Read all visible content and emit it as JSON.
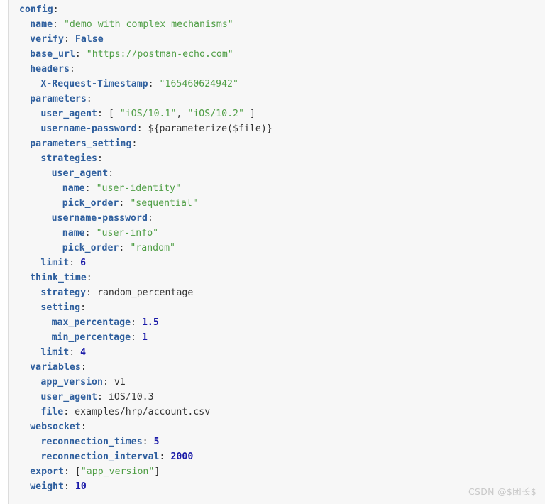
{
  "editor": {
    "language": "yaml",
    "background_color": "#f7f7f7",
    "page_background_color": "#ffffff",
    "gutter_border_color": "#dcdcdc",
    "colors": {
      "key": "#2f5f9e",
      "string": "#4f9e45",
      "number": "#1a1aa8",
      "constant": "#2f5f9e",
      "plain": "#333333",
      "punctuation": "#333333"
    },
    "lines": [
      {
        "indent": 0,
        "tokens": [
          {
            "t": "key",
            "v": "config"
          },
          {
            "t": "colon",
            "v": ":"
          }
        ]
      },
      {
        "indent": 1,
        "tokens": [
          {
            "t": "key",
            "v": "name"
          },
          {
            "t": "colon",
            "v": ": "
          },
          {
            "t": "str",
            "v": "\"demo with complex mechanisms\""
          }
        ]
      },
      {
        "indent": 1,
        "tokens": [
          {
            "t": "key",
            "v": "verify"
          },
          {
            "t": "colon",
            "v": ": "
          },
          {
            "t": "const",
            "v": "False"
          }
        ]
      },
      {
        "indent": 1,
        "tokens": [
          {
            "t": "key",
            "v": "base_url"
          },
          {
            "t": "colon",
            "v": ": "
          },
          {
            "t": "str",
            "v": "\"https://postman-echo.com\""
          }
        ]
      },
      {
        "indent": 1,
        "tokens": [
          {
            "t": "key",
            "v": "headers"
          },
          {
            "t": "colon",
            "v": ":"
          }
        ]
      },
      {
        "indent": 2,
        "tokens": [
          {
            "t": "key",
            "v": "X-Request-Timestamp"
          },
          {
            "t": "colon",
            "v": ": "
          },
          {
            "t": "str",
            "v": "\"165460624942\""
          }
        ]
      },
      {
        "indent": 1,
        "tokens": [
          {
            "t": "key",
            "v": "parameters"
          },
          {
            "t": "colon",
            "v": ":"
          }
        ]
      },
      {
        "indent": 2,
        "tokens": [
          {
            "t": "key",
            "v": "user_agent"
          },
          {
            "t": "colon",
            "v": ": "
          },
          {
            "t": "punct",
            "v": "[ "
          },
          {
            "t": "str",
            "v": "\"iOS/10.1\""
          },
          {
            "t": "punct",
            "v": ", "
          },
          {
            "t": "str",
            "v": "\"iOS/10.2\""
          },
          {
            "t": "punct",
            "v": " ]"
          }
        ]
      },
      {
        "indent": 2,
        "tokens": [
          {
            "t": "key",
            "v": "username-password"
          },
          {
            "t": "colon",
            "v": ": "
          },
          {
            "t": "plain",
            "v": "${parameterize($file)}"
          }
        ]
      },
      {
        "indent": 1,
        "tokens": [
          {
            "t": "key",
            "v": "parameters_setting"
          },
          {
            "t": "colon",
            "v": ":"
          }
        ]
      },
      {
        "indent": 2,
        "tokens": [
          {
            "t": "key",
            "v": "strategies"
          },
          {
            "t": "colon",
            "v": ":"
          }
        ]
      },
      {
        "indent": 3,
        "tokens": [
          {
            "t": "key",
            "v": "user_agent"
          },
          {
            "t": "colon",
            "v": ":"
          }
        ]
      },
      {
        "indent": 4,
        "tokens": [
          {
            "t": "key",
            "v": "name"
          },
          {
            "t": "colon",
            "v": ": "
          },
          {
            "t": "str",
            "v": "\"user-identity\""
          }
        ]
      },
      {
        "indent": 4,
        "tokens": [
          {
            "t": "key",
            "v": "pick_order"
          },
          {
            "t": "colon",
            "v": ": "
          },
          {
            "t": "str",
            "v": "\"sequential\""
          }
        ]
      },
      {
        "indent": 3,
        "tokens": [
          {
            "t": "key",
            "v": "username-password"
          },
          {
            "t": "colon",
            "v": ":"
          }
        ]
      },
      {
        "indent": 4,
        "tokens": [
          {
            "t": "key",
            "v": "name"
          },
          {
            "t": "colon",
            "v": ": "
          },
          {
            "t": "str",
            "v": "\"user-info\""
          }
        ]
      },
      {
        "indent": 4,
        "tokens": [
          {
            "t": "key",
            "v": "pick_order"
          },
          {
            "t": "colon",
            "v": ": "
          },
          {
            "t": "str",
            "v": "\"random\""
          }
        ]
      },
      {
        "indent": 2,
        "tokens": [
          {
            "t": "key",
            "v": "limit"
          },
          {
            "t": "colon",
            "v": ": "
          },
          {
            "t": "num",
            "v": "6"
          }
        ]
      },
      {
        "indent": 1,
        "tokens": [
          {
            "t": "key",
            "v": "think_time"
          },
          {
            "t": "colon",
            "v": ":"
          }
        ]
      },
      {
        "indent": 2,
        "tokens": [
          {
            "t": "key",
            "v": "strategy"
          },
          {
            "t": "colon",
            "v": ": "
          },
          {
            "t": "plain",
            "v": "random_percentage"
          }
        ]
      },
      {
        "indent": 2,
        "tokens": [
          {
            "t": "key",
            "v": "setting"
          },
          {
            "t": "colon",
            "v": ":"
          }
        ]
      },
      {
        "indent": 3,
        "tokens": [
          {
            "t": "key",
            "v": "max_percentage"
          },
          {
            "t": "colon",
            "v": ": "
          },
          {
            "t": "num",
            "v": "1.5"
          }
        ]
      },
      {
        "indent": 3,
        "tokens": [
          {
            "t": "key",
            "v": "min_percentage"
          },
          {
            "t": "colon",
            "v": ": "
          },
          {
            "t": "num",
            "v": "1"
          }
        ]
      },
      {
        "indent": 2,
        "tokens": [
          {
            "t": "key",
            "v": "limit"
          },
          {
            "t": "colon",
            "v": ": "
          },
          {
            "t": "num",
            "v": "4"
          }
        ]
      },
      {
        "indent": 1,
        "tokens": [
          {
            "t": "key",
            "v": "variables"
          },
          {
            "t": "colon",
            "v": ":"
          }
        ]
      },
      {
        "indent": 2,
        "tokens": [
          {
            "t": "key",
            "v": "app_version"
          },
          {
            "t": "colon",
            "v": ": "
          },
          {
            "t": "plain",
            "v": "v1"
          }
        ]
      },
      {
        "indent": 2,
        "tokens": [
          {
            "t": "key",
            "v": "user_agent"
          },
          {
            "t": "colon",
            "v": ": "
          },
          {
            "t": "plain",
            "v": "iOS/10.3"
          }
        ]
      },
      {
        "indent": 2,
        "tokens": [
          {
            "t": "key",
            "v": "file"
          },
          {
            "t": "colon",
            "v": ": "
          },
          {
            "t": "plain",
            "v": "examples/hrp/account.csv"
          }
        ]
      },
      {
        "indent": 1,
        "tokens": [
          {
            "t": "key",
            "v": "websocket"
          },
          {
            "t": "colon",
            "v": ":"
          }
        ]
      },
      {
        "indent": 2,
        "tokens": [
          {
            "t": "key",
            "v": "reconnection_times"
          },
          {
            "t": "colon",
            "v": ": "
          },
          {
            "t": "num",
            "v": "5"
          }
        ]
      },
      {
        "indent": 2,
        "tokens": [
          {
            "t": "key",
            "v": "reconnection_interval"
          },
          {
            "t": "colon",
            "v": ": "
          },
          {
            "t": "num",
            "v": "2000"
          }
        ]
      },
      {
        "indent": 1,
        "tokens": [
          {
            "t": "key",
            "v": "export"
          },
          {
            "t": "colon",
            "v": ": "
          },
          {
            "t": "punct",
            "v": "["
          },
          {
            "t": "str",
            "v": "\"app_version\""
          },
          {
            "t": "punct",
            "v": "]"
          }
        ]
      },
      {
        "indent": 1,
        "tokens": [
          {
            "t": "key",
            "v": "weight"
          },
          {
            "t": "colon",
            "v": ": "
          },
          {
            "t": "num",
            "v": "10"
          }
        ]
      }
    ]
  },
  "watermark": {
    "text": "CSDN @$团长$",
    "color": "#c9c9c9"
  }
}
